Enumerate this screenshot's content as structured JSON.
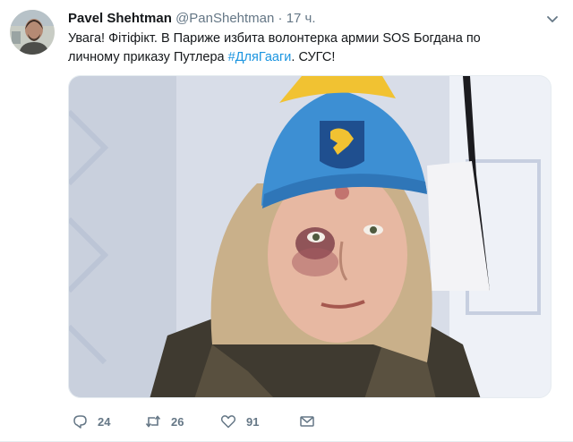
{
  "tweet": {
    "author_name": "Pavel Shehtman",
    "author_handle": "@PanShehtman",
    "separator": "·",
    "time": "17 ч.",
    "text_before": "Увага! Фітіфікт. В Париже избита волонтерка армии SOS Богдана по личному приказу Путлера ",
    "hashtag": "#ДляГааги",
    "text_after": ". СУГС!"
  },
  "actions": {
    "reply_count": "24",
    "retweet_count": "26",
    "like_count": "91"
  },
  "icons": {
    "reply": "reply-icon",
    "retweet": "retweet-icon",
    "like": "heart-icon",
    "message": "message-icon",
    "more": "chevron-down-icon"
  },
  "colors": {
    "text": "#14171a",
    "secondary": "#657786",
    "link": "#1b95e0"
  }
}
